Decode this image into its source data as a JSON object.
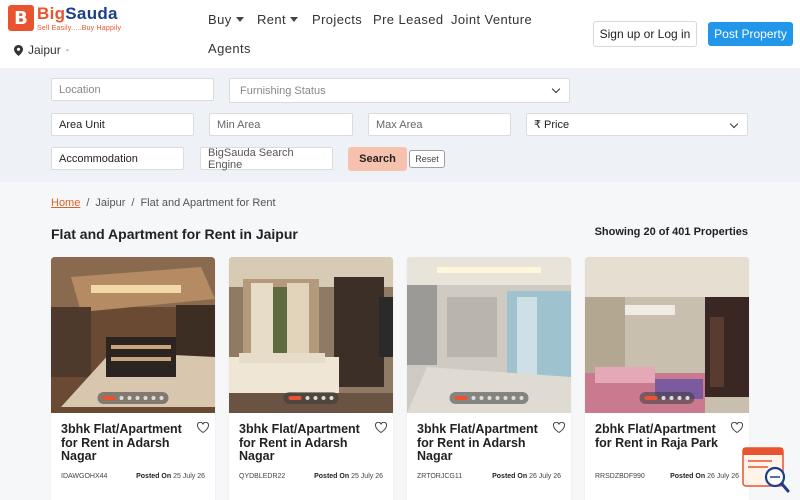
{
  "header": {
    "logo_letter": "B",
    "logo_name_a": "Big",
    "logo_name_b": "Sauda",
    "logo_tagline": "Sell Easily.....Buy Happily",
    "city": "Jaipur",
    "nav": [
      {
        "label": "Buy",
        "dropdown": true
      },
      {
        "label": "Rent",
        "dropdown": true
      },
      {
        "label": "Projects",
        "dropdown": false
      },
      {
        "label": "Pre Leased",
        "dropdown": false
      },
      {
        "label": "Joint Venture",
        "dropdown": false
      },
      {
        "label": "Agents",
        "dropdown": false
      }
    ],
    "signin_label": "Sign up or Log in",
    "post_label": "Post Property"
  },
  "filters": {
    "location_placeholder": "Location",
    "furnishing": "Furnishing Status",
    "area_unit": "Area Unit",
    "min_area": "Min Area",
    "max_area": "Max Area",
    "price": "₹ Price",
    "accommodation": "Accommodation",
    "engine_placeholder": "BigSauda Search Engine",
    "search_label": "Search",
    "reset_label": "Reset"
  },
  "breadcrumb": {
    "home": "Home",
    "city": "Jaipur",
    "current": "Flat and Apartment for Rent"
  },
  "page_title": "Flat and Apartment for Rent in Jaipur",
  "results_count": "Showing 20 of 401 Properties",
  "colors": {
    "brand_orange": "#e8542f",
    "brand_blue": "#1d3f8a",
    "post_button": "#2296e8",
    "search_button": "#f7c2ad"
  },
  "cards": [
    {
      "title": "3bhk Flat/Apartment for Rent in Adarsh Nagar",
      "code": "IDAWGOHX44",
      "posted_label": "Posted On",
      "posted_date": "25 July 26",
      "dots": 7,
      "active_dot": 0
    },
    {
      "title": "3bhk Flat/Apartment for Rent in Adarsh Nagar",
      "code": "QYDBLEDR22",
      "posted_label": "Posted On",
      "posted_date": "25 July 26",
      "dots": 5,
      "active_dot": 0
    },
    {
      "title": "3bhk Flat/Apartment for Rent in Adarsh Nagar",
      "code": "ZRTORJCG11",
      "posted_label": "Posted On",
      "posted_date": "26 July 26",
      "dots": 8,
      "active_dot": 0
    },
    {
      "title": "2bhk Flat/Apartment for Rent in Raja Park",
      "code": "RRSDZBDF990",
      "posted_label": "Posted On",
      "posted_date": "26 July 26",
      "dots": 5,
      "active_dot": 0
    }
  ]
}
